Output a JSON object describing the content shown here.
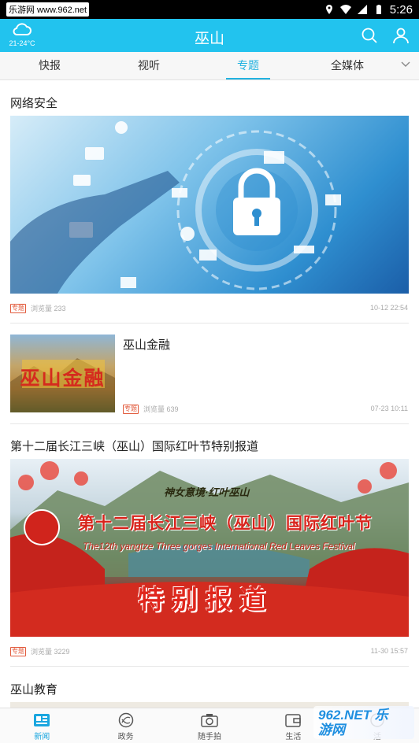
{
  "status_bar": {
    "watermark": "乐游网 www.962.net",
    "time": "5:26"
  },
  "header": {
    "temp": "21-24°C",
    "title": "巫山"
  },
  "tabs": [
    {
      "label": "快报",
      "active": false
    },
    {
      "label": "视听",
      "active": false
    },
    {
      "label": "专题",
      "active": true
    },
    {
      "label": "全媒体",
      "active": false
    }
  ],
  "articles": [
    {
      "title": "网络安全",
      "badge": "专题",
      "views": "浏览量 233",
      "time": "10-12 22:54"
    },
    {
      "title": "巫山金融",
      "badge": "专题",
      "views": "浏览量 639",
      "time": "07-23 10:11",
      "thumb_text": "巫山金融"
    },
    {
      "title": "第十二届长江三峡（巫山）国际红叶节特别报道",
      "badge": "专题",
      "views": "浏览量 3229",
      "time": "11-30 15:57",
      "banner_top": "神女意境·红叶巫山",
      "banner_main": "第十二届长江三峡（巫山）国际红叶节",
      "banner_en": "The12th yangtze Three gorges International Red Leaves Festival",
      "banner_sub": "特别报道"
    },
    {
      "title": "巫山教育"
    }
  ],
  "bottom_nav": [
    {
      "label": "新闻",
      "icon": "news-icon",
      "active": true
    },
    {
      "label": "政务",
      "icon": "government-icon",
      "active": false
    },
    {
      "label": "随手拍",
      "icon": "camera-icon",
      "active": false
    },
    {
      "label": "生活",
      "icon": "life-icon",
      "active": false
    },
    {
      "label": "活",
      "icon": "activity-icon",
      "active": false
    }
  ],
  "watermark_br": "962.NET 乐游网",
  "colors": {
    "header": "#22c3ee",
    "accent": "#22b2e0",
    "badge": "#e25b3d"
  }
}
